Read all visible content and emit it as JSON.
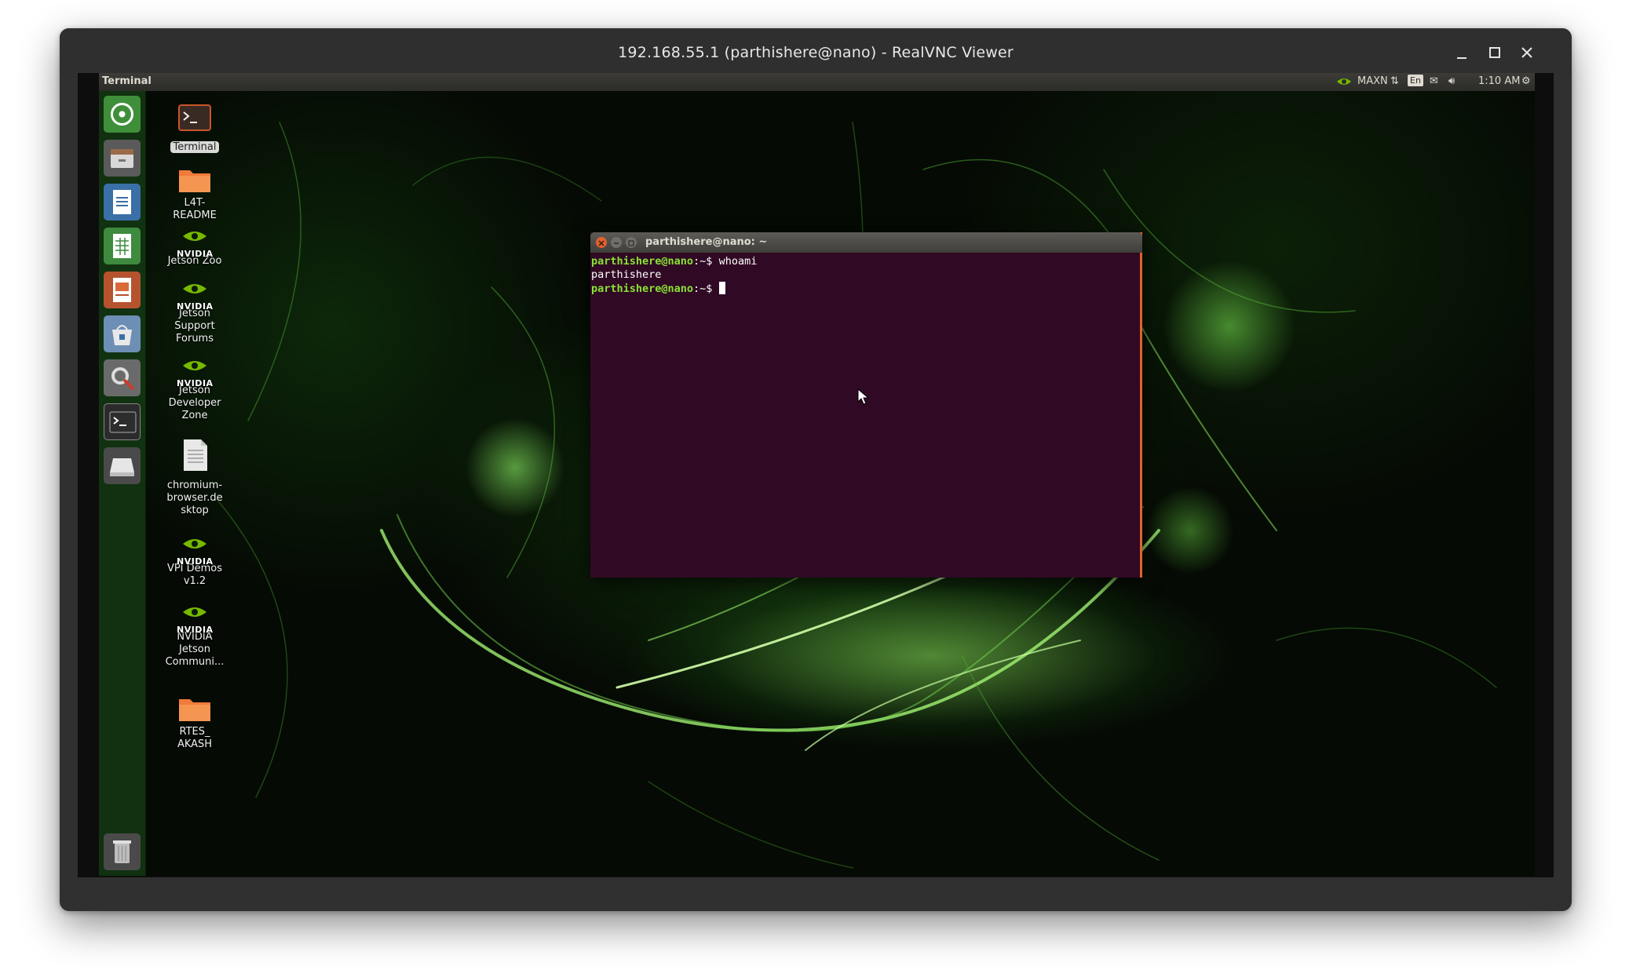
{
  "viewer": {
    "title": "192.168.55.1 (parthishere@nano) - RealVNC Viewer",
    "minimize_label": "–",
    "maximize_label": "□",
    "close_label": "✕"
  },
  "top_panel": {
    "app_title": "Terminal",
    "power_mode": "MAXN",
    "keyboard_layout": "En",
    "clock": "1:10 AM",
    "icons": [
      "nvidia-icon",
      "network-icon",
      "keyboard-icon",
      "mail-icon",
      "volume-icon",
      "settings-gear-icon"
    ]
  },
  "launcher": {
    "items": [
      {
        "name": "ubuntu-dash",
        "icon": "dash-icon"
      },
      {
        "name": "files",
        "icon": "files-icon"
      },
      {
        "name": "libreoffice-writer",
        "icon": "writer-icon"
      },
      {
        "name": "libreoffice-calc",
        "icon": "calc-icon"
      },
      {
        "name": "libreoffice-impress",
        "icon": "impress-icon"
      },
      {
        "name": "software-center",
        "icon": "software-icon"
      },
      {
        "name": "system-settings",
        "icon": "settings-icon"
      },
      {
        "name": "terminal",
        "icon": "terminal-icon"
      },
      {
        "name": "drive",
        "icon": "drive-icon"
      },
      {
        "name": "trash",
        "icon": "trash-icon"
      }
    ]
  },
  "desktop_icons": [
    {
      "name": "terminal",
      "label": "Terminal",
      "icon": "terminal-icon"
    },
    {
      "name": "l4t-readme",
      "label": "L4T-README",
      "icon": "folder-icon"
    },
    {
      "name": "jetson-zoo",
      "label": "Jetson Zoo",
      "icon": "nvidia-icon",
      "brand": "NVIDIA"
    },
    {
      "name": "jetson-support-forums",
      "label": "Jetson Support Forums",
      "icon": "nvidia-icon",
      "brand": "NVIDIA"
    },
    {
      "name": "jetson-developer-zone",
      "label": "Jetson Developer Zone",
      "icon": "nvidia-icon",
      "brand": "NVIDIA"
    },
    {
      "name": "chromium-browser-desktop",
      "label": "chromium-browser.desktop",
      "icon": "file-icon"
    },
    {
      "name": "vpi-demos",
      "label": "VPI Demos v1.2",
      "icon": "nvidia-icon",
      "brand": "NVIDIA"
    },
    {
      "name": "nvidia-jetson-community",
      "label": "NVIDIA Jetson Communi...",
      "icon": "nvidia-icon",
      "brand": "NVIDIA"
    },
    {
      "name": "rtes-akash",
      "label": "RTES_ AKASH",
      "icon": "folder-icon"
    }
  ],
  "terminal": {
    "title": "parthishere@nano: ~",
    "lines": [
      {
        "prompt": "parthishere@nano",
        "path": ":~$",
        "command": " whoami"
      },
      {
        "output": "parthishere"
      },
      {
        "prompt": "parthishere@nano",
        "path": ":~$",
        "command": " "
      }
    ]
  },
  "colors": {
    "nvidia_green": "#76b900",
    "terminal_bg": "#300a24",
    "prompt_green": "#8ae234",
    "close_button": "#e0612f"
  }
}
